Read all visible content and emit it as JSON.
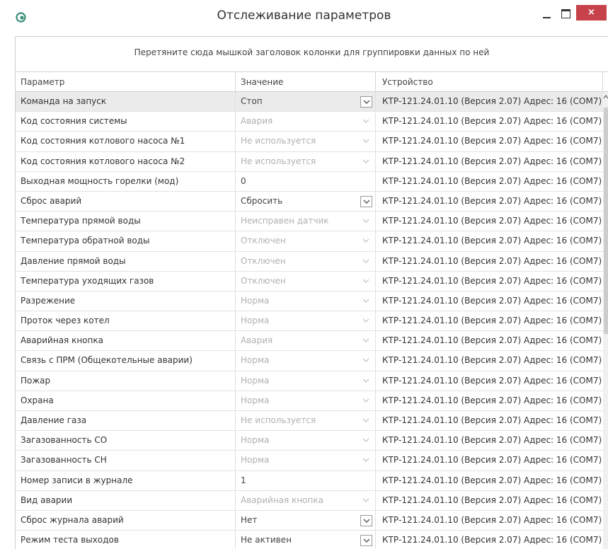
{
  "window": {
    "title": "Отслеживание параметров",
    "close_label": "×",
    "app_icon": "app-logo-icon",
    "min_icon": "minimize-icon",
    "max_icon": "maximize-icon"
  },
  "group_panel": {
    "hint": "Перетяните сюда мышкой заголовок колонки для группировки данных по ней"
  },
  "columns": {
    "param": "Параметр",
    "value": "Значение",
    "device": "Устройство"
  },
  "colors": {
    "close_button": "#c7424b",
    "selected_row": "#ebebeb",
    "disabled_text": "#b0b0b0"
  },
  "rows": [
    {
      "param": "Команда на запуск",
      "value": "Стоп",
      "device": "КТР-121.24.01.10 (Версия 2.07) Адрес: 16 (COM7)"
    },
    {
      "param": "Код состояния системы",
      "value": "Авария",
      "device": "КТР-121.24.01.10 (Версия 2.07) Адрес: 16 (COM7)"
    },
    {
      "param": "Код состояния котлового насоса №1",
      "value": "Не используется",
      "device": "КТР-121.24.01.10 (Версия 2.07) Адрес: 16 (COM7)"
    },
    {
      "param": "Код состояния котлового насоса №2",
      "value": "Не используется",
      "device": "КТР-121.24.01.10 (Версия 2.07) Адрес: 16 (COM7)"
    },
    {
      "param": "Выходная мощность горелки (мод)",
      "value": "0",
      "device": "КТР-121.24.01.10 (Версия 2.07) Адрес: 16 (COM7)"
    },
    {
      "param": "Сброс аварий",
      "value": "Сбросить",
      "device": "КТР-121.24.01.10 (Версия 2.07) Адрес: 16 (COM7)"
    },
    {
      "param": "Температура прямой воды",
      "value": "Неисправен датчик",
      "device": "КТР-121.24.01.10 (Версия 2.07) Адрес: 16 (COM7)"
    },
    {
      "param": "Температура обратной воды",
      "value": "Отключен",
      "device": "КТР-121.24.01.10 (Версия 2.07) Адрес: 16 (COM7)"
    },
    {
      "param": "Давление прямой воды",
      "value": "Отключен",
      "device": "КТР-121.24.01.10 (Версия 2.07) Адрес: 16 (COM7)"
    },
    {
      "param": "Температура уходящих газов",
      "value": "Отключен",
      "device": "КТР-121.24.01.10 (Версия 2.07) Адрес: 16 (COM7)"
    },
    {
      "param": "Разрежение",
      "value": "Норма",
      "device": "КТР-121.24.01.10 (Версия 2.07) Адрес: 16 (COM7)"
    },
    {
      "param": "Проток через котел",
      "value": "Норма",
      "device": "КТР-121.24.01.10 (Версия 2.07) Адрес: 16 (COM7)"
    },
    {
      "param": "Аварийная кнопка",
      "value": "Авария",
      "device": "КТР-121.24.01.10 (Версия 2.07) Адрес: 16 (COM7)"
    },
    {
      "param": "Связь с ПРМ (Общекотельные аварии)",
      "value": "Норма",
      "device": "КТР-121.24.01.10 (Версия 2.07) Адрес: 16 (COM7)"
    },
    {
      "param": "Пожар",
      "value": "Норма",
      "device": "КТР-121.24.01.10 (Версия 2.07) Адрес: 16 (COM7)"
    },
    {
      "param": "Охрана",
      "value": "Норма",
      "device": "КТР-121.24.01.10 (Версия 2.07) Адрес: 16 (COM7)"
    },
    {
      "param": "Давление газа",
      "value": "Не используется",
      "device": "КТР-121.24.01.10 (Версия 2.07) Адрес: 16 (COM7)"
    },
    {
      "param": "Загазованность СО",
      "value": "Норма",
      "device": "КТР-121.24.01.10 (Версия 2.07) Адрес: 16 (COM7)"
    },
    {
      "param": "Загазованность СН",
      "value": "Норма",
      "device": "КТР-121.24.01.10 (Версия 2.07) Адрес: 16 (COM7)"
    },
    {
      "param": "Номер записи в журнале",
      "value": "1",
      "device": "КТР-121.24.01.10 (Версия 2.07) Адрес: 16 (COM7)"
    },
    {
      "param": "Вид аварии",
      "value": "Аварийная кнопка",
      "device": "КТР-121.24.01.10 (Версия 2.07) Адрес: 16 (COM7)"
    },
    {
      "param": "Сброс журнала аварий",
      "value": "Нет",
      "device": "КТР-121.24.01.10 (Версия 2.07) Адрес: 16 (COM7)"
    },
    {
      "param": "Режим теста выходов",
      "value": "Не активен",
      "device": "КТР-121.24.01.10 (Версия 2.07) Адрес: 16 (COM7)"
    }
  ]
}
